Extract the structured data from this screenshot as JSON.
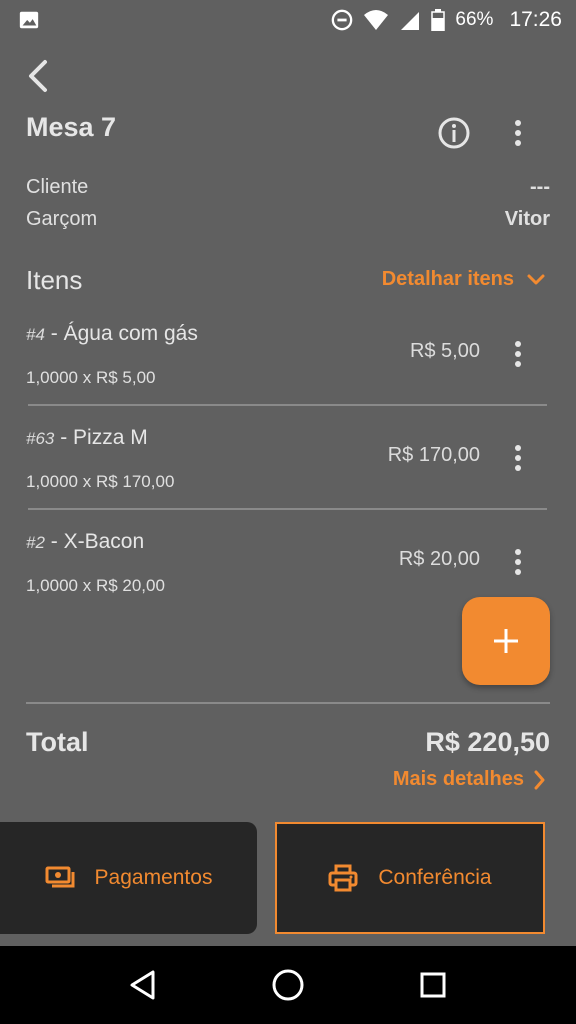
{
  "status": {
    "battery": "66%",
    "time": "17:26"
  },
  "header": {
    "title": "Mesa 7"
  },
  "meta": {
    "cliente_label": "Cliente",
    "cliente_value": "---",
    "garcom_label": "Garçom",
    "garcom_value": "Vitor"
  },
  "items_section": {
    "title": "Itens",
    "detail_link": "Detalhar itens"
  },
  "items": [
    {
      "num": "#4",
      "name": " - Água com gás",
      "qty": "1,0000 x R$ 5,00",
      "price": "R$ 5,00"
    },
    {
      "num": "#63",
      "name": " - Pizza M",
      "qty": "1,0000 x R$ 170,00",
      "price": "R$ 170,00"
    },
    {
      "num": "#2",
      "name": " - X-Bacon",
      "qty": "1,0000 x R$ 20,00",
      "price": "R$ 20,00"
    }
  ],
  "total": {
    "label": "Total",
    "value": "R$ 220,50",
    "more_link": "Mais detalhes"
  },
  "actions": {
    "payments": "Pagamentos",
    "conference": "Conferência"
  },
  "colors": {
    "accent": "#f28a30",
    "background": "#606060",
    "button_bg": "#262626"
  }
}
